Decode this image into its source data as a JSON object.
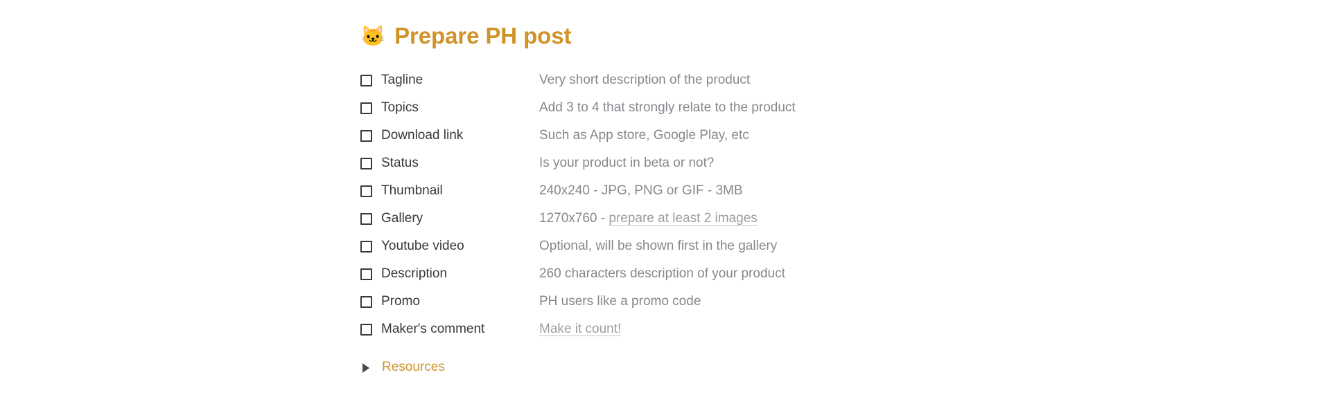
{
  "header": {
    "emoji": "🐱",
    "emoji_name": "cat-face-emoji",
    "title": "Prepare PH post",
    "accent_color": "#cf9328"
  },
  "checklist": {
    "items": [
      {
        "label": "Tagline",
        "desc": "Very short description of the product",
        "checked": false,
        "link": null
      },
      {
        "label": "Topics",
        "desc": "Add 3 to 4 that strongly relate to the product",
        "checked": false,
        "link": null
      },
      {
        "label": "Download link",
        "desc": "Such as App store, Google Play, etc",
        "checked": false,
        "link": null
      },
      {
        "label": "Status",
        "desc": "Is your product in beta or not?",
        "checked": false,
        "link": null
      },
      {
        "label": "Thumbnail",
        "desc": "240x240 - JPG, PNG or GIF - 3MB",
        "checked": false,
        "link": null
      },
      {
        "label": "Gallery",
        "desc": "1270x760 - ",
        "checked": false,
        "link": "prepare at least 2 images"
      },
      {
        "label": "Youtube video",
        "desc": "Optional, will be shown first in the gallery",
        "checked": false,
        "link": null
      },
      {
        "label": "Description",
        "desc": "260 characters description of your product",
        "checked": false,
        "link": null
      },
      {
        "label": "Promo",
        "desc": "PH users like a promo code",
        "checked": false,
        "link": null
      },
      {
        "label": "Maker's comment",
        "desc": "",
        "checked": false,
        "link": "Make it count!"
      }
    ]
  },
  "resources": {
    "label": "Resources",
    "expanded": false,
    "icon": "triangle-right-icon"
  },
  "colors": {
    "accent": "#cf9328",
    "label_text": "#35393d",
    "desc_text": "#84888c",
    "link_text": "#9a9ea2",
    "checkbox_border": "#3a3a3a",
    "background": "#ffffff"
  }
}
